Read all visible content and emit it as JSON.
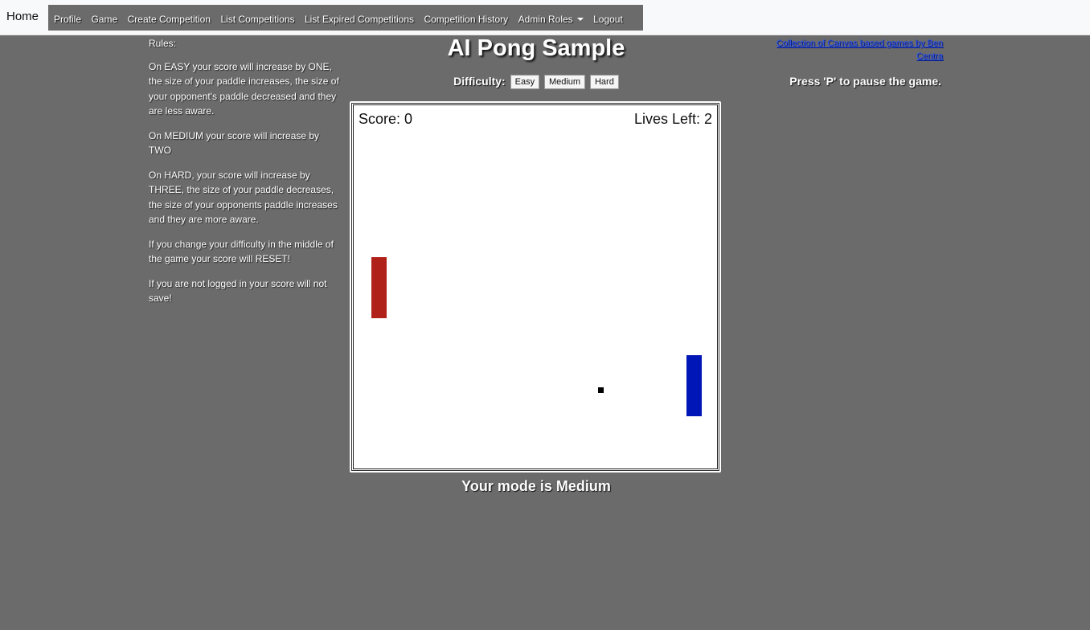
{
  "nav": {
    "brand": "Home",
    "links": [
      "Profile",
      "Game",
      "Create Competition",
      "List Competitions",
      "List Expired Competitions",
      "Competition History"
    ],
    "admin_roles": "Admin Roles",
    "logout": "Logout"
  },
  "rules": {
    "heading": "Rules:",
    "easy": "On EASY your score will increase by ONE, the size of your paddle increases, the size of your opponent's paddle decreased and they are less aware.",
    "medium": "On MEDIUM your score will increase by TWO",
    "hard": "On HARD, your score will increase by THREE, the size of your paddle decreases, the size of your opponents paddle increases and they are more aware.",
    "reset": "If you change your difficulty in the middle of the game your score will RESET!",
    "login": "If you are not logged in your score will not save!"
  },
  "game": {
    "title": "AI Pong Sample",
    "difficulty_label": "Difficulty:",
    "buttons": {
      "easy": "Easy",
      "medium": "Medium",
      "hard": "Hard"
    },
    "score_text": "Score: 0",
    "lives_text": "Lives Left: 2",
    "mode_text": "Your mode is Medium",
    "player_paddle_color": "#b0211a",
    "opponent_paddle_color": "#0016b6"
  },
  "side": {
    "collection_link": "Collection of Canvas based games by Ben Centra",
    "pause_hint": "Press 'P' to pause the game."
  }
}
